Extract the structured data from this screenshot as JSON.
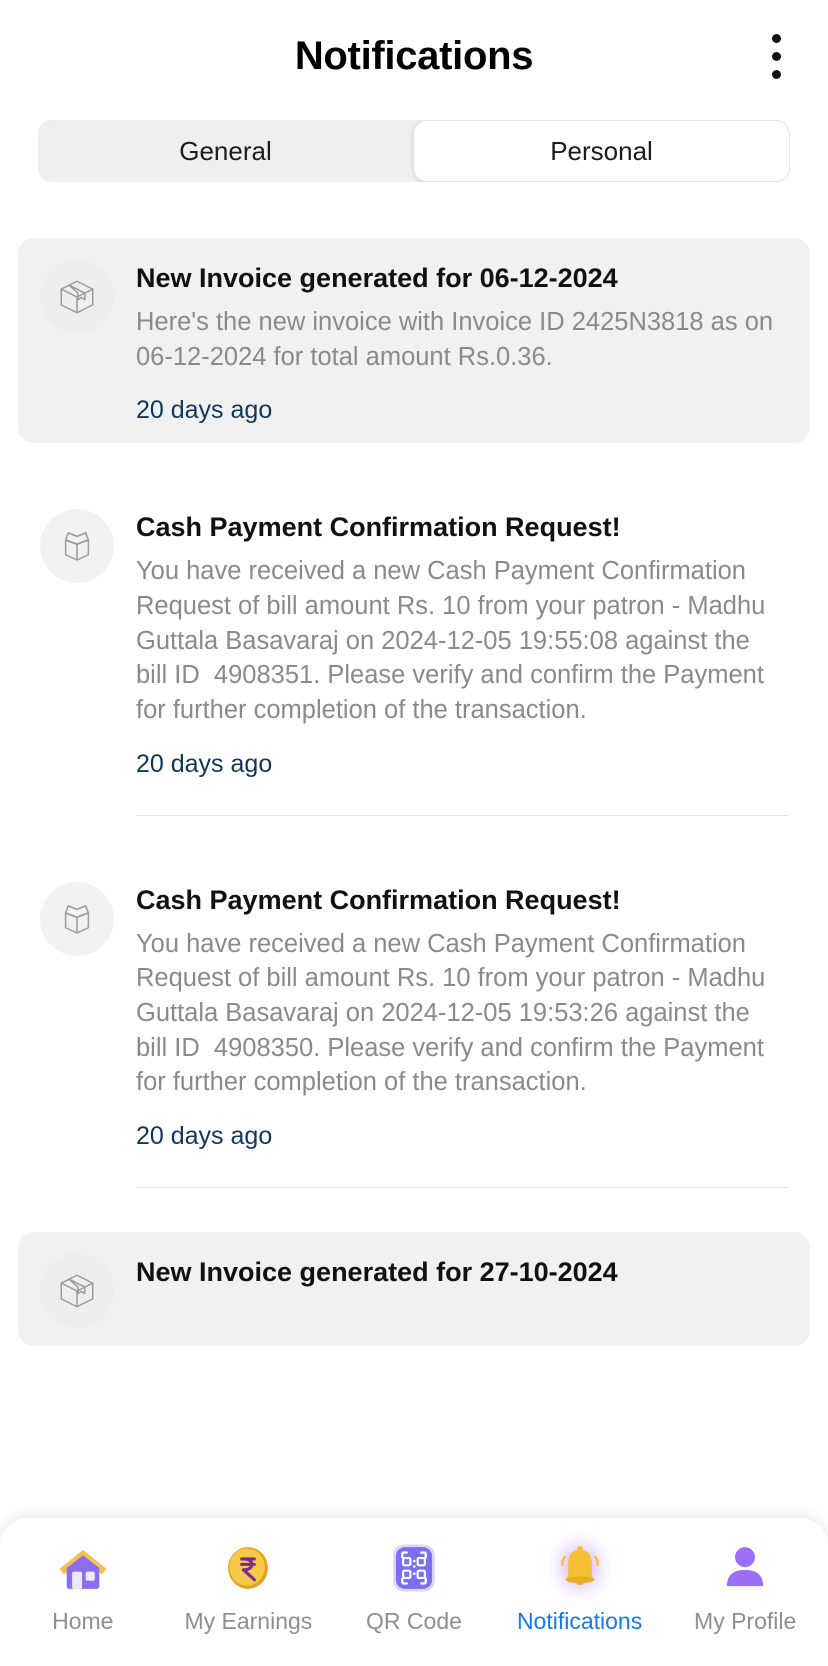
{
  "header": {
    "title": "Notifications",
    "menu_icon": "kebab-menu-icon"
  },
  "tabs": [
    {
      "label": "General",
      "active": false
    },
    {
      "label": "Personal",
      "active": true
    }
  ],
  "notifications": [
    {
      "icon": "closed-box-icon",
      "title": "New Invoice generated for 06-12-2024",
      "text": "Here's the new invoice with Invoice ID 2425N3818 as on 06-12-2024 for total amount Rs.0.36.",
      "time": "20 days ago",
      "style": "shaded"
    },
    {
      "icon": "open-box-icon",
      "title": "Cash Payment Confirmation Request!",
      "text": "You have received a new Cash Payment Confirmation Request of bill amount Rs. 10 from your patron - Madhu Guttala Basavaraj on 2024-12-05 19:55:08 against the bill ID  4908351. Please verify and confirm the Payment for further completion of the transaction.",
      "time": "20 days ago",
      "style": "plain"
    },
    {
      "icon": "open-box-icon",
      "title": "Cash Payment Confirmation Request!",
      "text": "You have received a new Cash Payment Confirmation Request of bill amount Rs. 10 from your patron - Madhu Guttala Basavaraj on 2024-12-05 19:53:26 against the bill ID  4908350. Please verify and confirm the Payment for further completion of the transaction.",
      "time": "20 days ago",
      "style": "plain"
    },
    {
      "icon": "closed-box-icon",
      "title": "New Invoice generated for 27-10-2024",
      "text": "",
      "time": "",
      "style": "shaded"
    }
  ],
  "bottom_nav": [
    {
      "label": "Home",
      "icon": "house-icon",
      "active": false
    },
    {
      "label": "My Earnings",
      "icon": "coin-rupee-icon",
      "active": false
    },
    {
      "label": "QR Code",
      "icon": "qr-code-icon",
      "active": false
    },
    {
      "label": "Notifications",
      "icon": "bell-icon",
      "active": true
    },
    {
      "label": "My Profile",
      "icon": "person-icon",
      "active": false
    }
  ],
  "colors": {
    "active_nav": "#1478f0",
    "inactive_nav": "#8e8e93",
    "timestamp": "#11365c",
    "body_text": "#8a8a8a",
    "card_bg": "#f1f1f1",
    "tab_bg": "#efefef",
    "purple": "#8b5cf6",
    "gold": "#f5c033"
  }
}
